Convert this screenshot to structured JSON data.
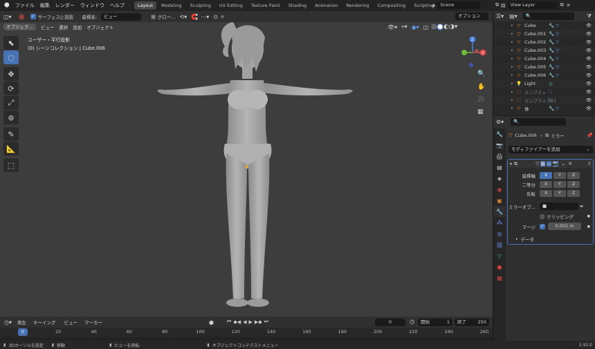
{
  "topbar": {
    "menus": [
      "ファイル",
      "編集",
      "レンダー",
      "ウィンドウ",
      "ヘルプ"
    ],
    "workspaces": [
      "Layout",
      "Modeling",
      "Sculpting",
      "UV Editing",
      "Texture Paint",
      "Shading",
      "Animation",
      "Rendering",
      "Compositing",
      "Scripting"
    ],
    "scene": "Scene",
    "view_layer": "View Layer"
  },
  "viewport": {
    "surface_project": "サーフェスに投影",
    "orientation_label": "座標系:",
    "orientation_value": "ビュー",
    "transform_space": "グロー...",
    "options": "オプション",
    "mode": "オブジェク...",
    "menus": [
      "ビュー",
      "選択",
      "追加",
      "オブジェクト"
    ],
    "info_line1": "ユーザー・平行投影",
    "info_line2": "(0) シーンコレクション | Cube.006"
  },
  "outliner": {
    "items": [
      {
        "name": "Cube",
        "dim": false
      },
      {
        "name": "Cube.001",
        "dim": false
      },
      {
        "name": "Cube.002",
        "dim": false
      },
      {
        "name": "Cube.003",
        "dim": false
      },
      {
        "name": "Cube.004",
        "dim": false
      },
      {
        "name": "Cube.005",
        "dim": false
      },
      {
        "name": "Cube.006",
        "dim": false
      },
      {
        "name": "Light",
        "dim": false
      },
      {
        "name": "エンプティ",
        "dim": true
      },
      {
        "name": "エンプティ.001",
        "dim": true
      },
      {
        "name": "体",
        "dim": false
      }
    ]
  },
  "properties": {
    "object_name": "Cube.006",
    "modifier_name": "ミラー",
    "add_modifier": "モディファイアーを追加",
    "axis_label": "座標軸",
    "bisect_label": "二等分",
    "flip_label": "反転",
    "axes": [
      "X",
      "Y",
      "Z"
    ],
    "mirror_object_label": "ミラーオブ...",
    "clipping_label": "クリッピング",
    "merge_label": "マージ",
    "merge_value": "0.001 m",
    "data_label": "データ"
  },
  "timeline": {
    "playback": "再生",
    "keying": "キーイング",
    "view": "ビュー",
    "marker": "マーカー",
    "current_frame": "0",
    "start_label": "開始",
    "start_value": "1",
    "end_label": "終了",
    "end_value": "250",
    "ticks": [
      0,
      20,
      40,
      60,
      80,
      100,
      120,
      140,
      160,
      180,
      200,
      220,
      240,
      260
    ]
  },
  "statusbar": {
    "set_cursor": "3Dカーソルを設定",
    "move": "移動",
    "rotate_view": "ビューを回転",
    "context_menu": "オブジェクトコンテクストメニュー",
    "version": "2.92.0"
  },
  "colors": {
    "accent": "#4772b3",
    "active_tab": "#474747",
    "viewport_bg": "#3d3d3d",
    "mesh": "#a8a8a8"
  }
}
